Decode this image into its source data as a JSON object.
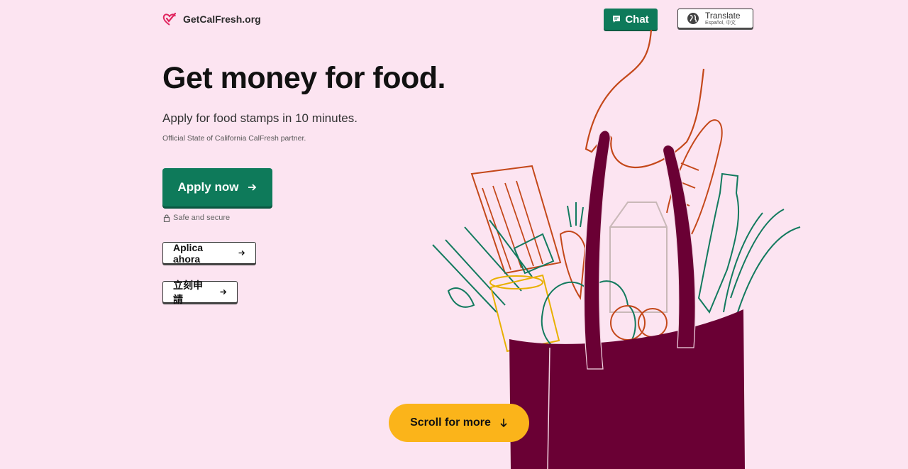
{
  "header": {
    "logo_text": "GetCalFresh.org",
    "logo_icon": "heart-check-icon",
    "chat_label": "Chat",
    "chat_icon": "chat-bubble-icon",
    "translate_label": "Translate",
    "translate_sub": "Español, 中文",
    "translate_icon": "globe-icon"
  },
  "hero": {
    "title": "Get money for food.",
    "subtitle": "Apply for food stamps in 10 minutes.",
    "partner_note": "Official State of California CalFresh partner.",
    "apply_label": "Apply now",
    "secure_label": "Safe and secure",
    "spanish_label": "Aplica ahora",
    "chinese_label": "立刻申請",
    "scroll_label": "Scroll for more"
  },
  "colors": {
    "background": "#fce4f1",
    "primary": "#0e7a5a",
    "accent": "#fbb41a",
    "bag": "#6a0034"
  }
}
